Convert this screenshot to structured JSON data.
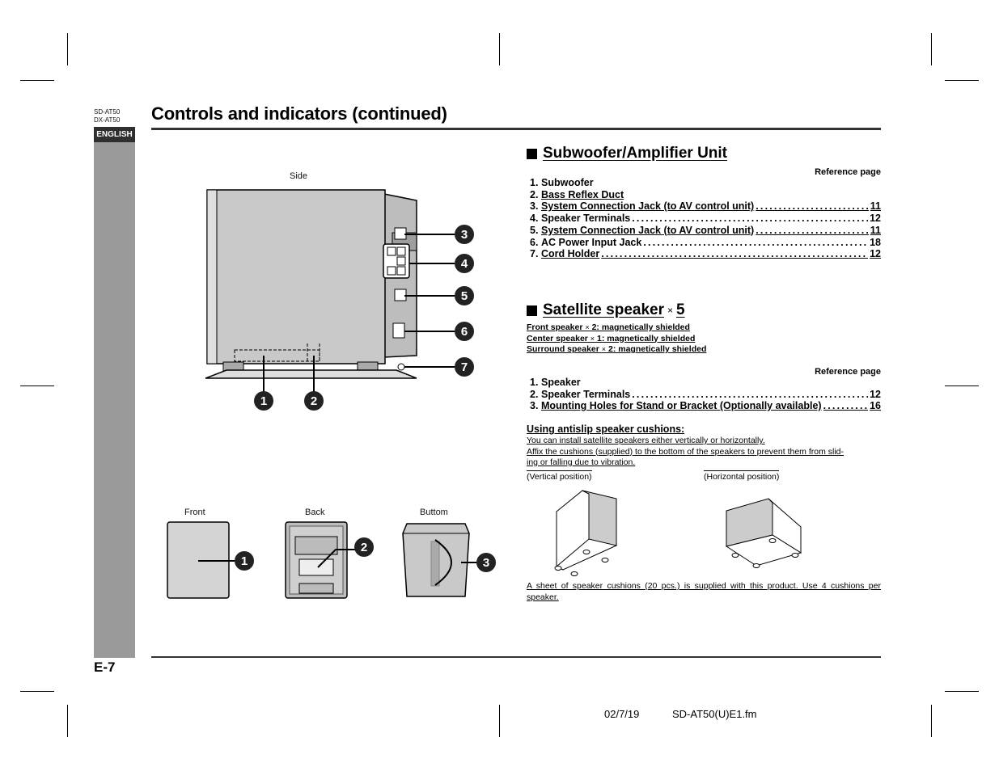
{
  "header": {
    "models": [
      "SD-AT50",
      "DX-AT50"
    ],
    "language_tab": "ENGLISH",
    "title": "Controls and indicators (continued)"
  },
  "figures": {
    "side_label": "Side",
    "front_label": "Front",
    "back_label": "Back",
    "bottom_label": "Buttom",
    "side_callouts": [
      "1",
      "2",
      "3",
      "4",
      "5",
      "6",
      "7"
    ],
    "speaker_callouts": [
      "1",
      "2",
      "3"
    ]
  },
  "subwoofer": {
    "heading": "Subwoofer/Amplifier Unit",
    "ref_label": "Reference page",
    "items": [
      {
        "num": "1.",
        "label": "Subwoofer",
        "page": "",
        "underline": false
      },
      {
        "num": "2.",
        "label": "Bass Reflex Duct",
        "page": "",
        "underline": true
      },
      {
        "num": "3.",
        "label": "System Connection Jack (to AV control unit)",
        "page": "11",
        "underline": true
      },
      {
        "num": "4.",
        "label": "Speaker Terminals",
        "page": "12",
        "underline": false
      },
      {
        "num": "5.",
        "label": "System Connection Jack (to AV control unit)",
        "page": "11",
        "underline": true
      },
      {
        "num": "6.",
        "label": "AC Power Input Jack",
        "page": "18",
        "underline": false
      },
      {
        "num": "7.",
        "label": "Cord Holder",
        "page": "12",
        "underline": true
      }
    ]
  },
  "satellite": {
    "heading": "Satellite speaker",
    "times": "×",
    "count": "5",
    "shielded": [
      {
        "name": "Front speaker",
        "times": "×",
        "rest": "2: magnetically shielded"
      },
      {
        "name": "Center speaker",
        "times": "×",
        "rest": "1: magnetically shielded"
      },
      {
        "name": "Surround speaker",
        "times": "×",
        "rest": "2: magnetically shielded"
      }
    ],
    "ref_label": "Reference page",
    "items": [
      {
        "num": "1.",
        "label": "Speaker",
        "page": "",
        "underline": false
      },
      {
        "num": "2.",
        "label": "Speaker Terminals",
        "page": "12",
        "underline": false
      },
      {
        "num": "3.",
        "label": "Mounting Holes for Stand or Bracket (Optionally available)",
        "page": "16",
        "underline": true
      }
    ]
  },
  "cushions": {
    "heading": "Using antislip speaker cushions:",
    "lines": [
      "You can install satellite speakers either vertically or horizontally.",
      "Affix the cushions (supplied) to the bottom of the speakers to prevent them from slid-",
      "ing or falling due to vibration."
    ],
    "vertical_label": "(Vertical position)",
    "horizontal_label": "(Horizontal position)",
    "note": "A sheet of speaker cushions (20 pcs.) is supplied with this product. Use 4 cushions per speaker."
  },
  "footer": {
    "page_number": "E-7",
    "date": "02/7/19",
    "filename": "SD-AT50(U)E1.fm"
  },
  "colors": {
    "tab_dark": "#2f2f2f",
    "side_bar_gray": "#9a9a9a",
    "rule": "#333333"
  }
}
